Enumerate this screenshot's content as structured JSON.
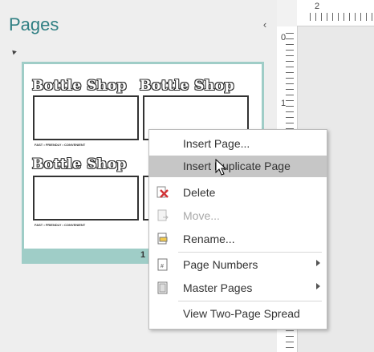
{
  "pane": {
    "title": "Pages",
    "collapse_glyph": "‹",
    "page_number": "1"
  },
  "thumbnail": {
    "label_title": "Bottle Shop",
    "tagline": "FAST • FRIENDLY • CONVENIENT"
  },
  "ruler": {
    "top_number": "2",
    "left_numbers": [
      "0",
      "1"
    ]
  },
  "context_menu": {
    "items": [
      {
        "label": "Insert Page...",
        "icon": "none"
      },
      {
        "label": "Insert Duplicate Page",
        "icon": "none"
      },
      {
        "label": "Delete",
        "icon": "delete-x-icon"
      },
      {
        "label": "Move...",
        "icon": "move-page-icon"
      },
      {
        "label": "Rename...",
        "icon": "rename-icon"
      },
      {
        "label": "Page Numbers",
        "icon": "page-numbers-icon"
      },
      {
        "label": "Master Pages",
        "icon": "master-pages-icon"
      },
      {
        "label": "View Two-Page Spread",
        "icon": "none"
      }
    ]
  },
  "colors": {
    "accent": "#2f7f83",
    "thumb_border": "#9fcdc7",
    "highlight": "#c6c6c6",
    "delete_red": "#d13438"
  }
}
